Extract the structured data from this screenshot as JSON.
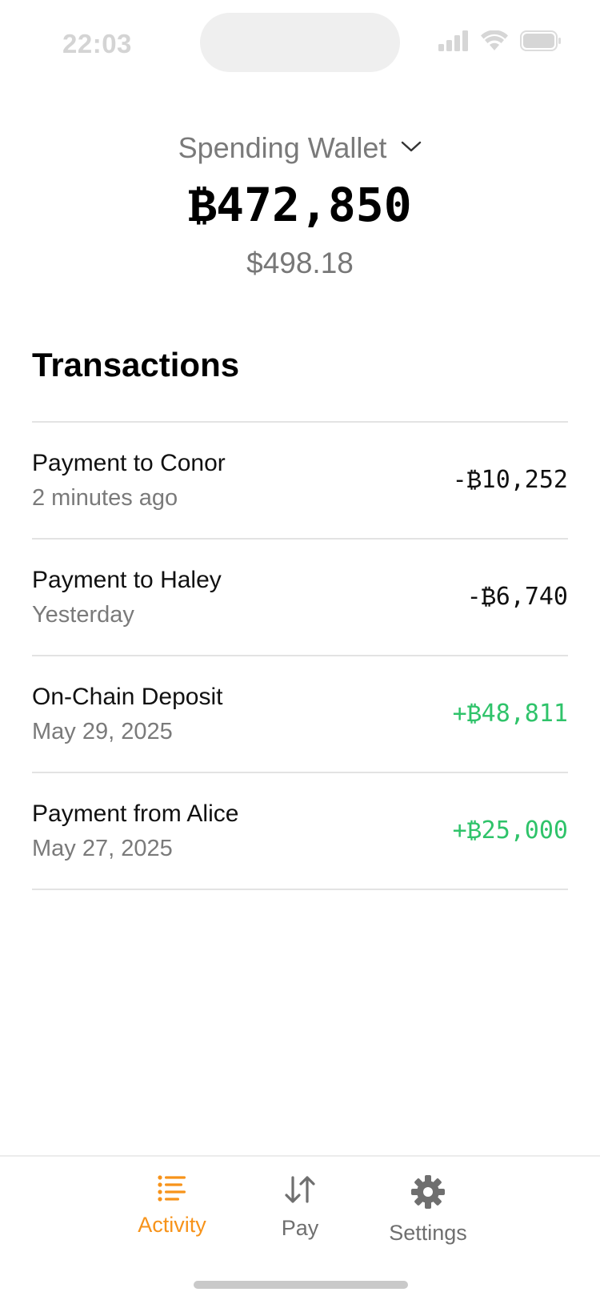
{
  "status_bar": {
    "time": "22:03"
  },
  "wallet": {
    "name": "Spending Wallet",
    "balance_btc": "₿472,850",
    "balance_fiat": "$498.18"
  },
  "transactions": {
    "heading": "Transactions",
    "items": [
      {
        "title": "Payment to Conor",
        "subtitle": "2 minutes ago",
        "amount": "-₿10,252",
        "direction": "outgoing"
      },
      {
        "title": "Payment to Haley",
        "subtitle": "Yesterday",
        "amount": "-₿6,740",
        "direction": "outgoing"
      },
      {
        "title": "On-Chain Deposit",
        "subtitle": "May 29, 2025",
        "amount": "+₿48,811",
        "direction": "incoming"
      },
      {
        "title": "Payment from Alice",
        "subtitle": "May 27, 2025",
        "amount": "+₿25,000",
        "direction": "incoming"
      }
    ]
  },
  "tabs": [
    {
      "label": "Activity",
      "icon": "activity-list-icon",
      "active": true
    },
    {
      "label": "Pay",
      "icon": "arrows-up-down-icon",
      "active": false
    },
    {
      "label": "Settings",
      "icon": "gear-icon",
      "active": false
    }
  ],
  "colors": {
    "accent": "#f7931a",
    "positive": "#2fc36a",
    "muted_text": "#7a7a7a",
    "divider": "#e3e3e3"
  }
}
